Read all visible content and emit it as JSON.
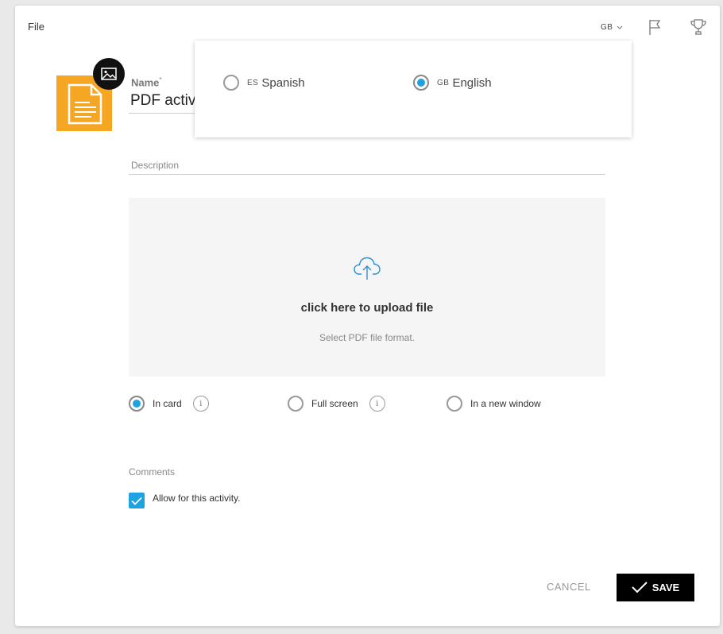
{
  "header": {
    "section_label": "File",
    "language_code": "GB"
  },
  "name_field": {
    "label": "Name",
    "required_mark": "*",
    "value": "PDF activity"
  },
  "description_field": {
    "label": "Description"
  },
  "upload": {
    "title": "click here to upload file",
    "hint": "Select PDF file format."
  },
  "display_options": [
    {
      "label": "In card",
      "selected": true,
      "info": "i"
    },
    {
      "label": "Full screen",
      "selected": false,
      "info": "i"
    },
    {
      "label": "In a new window",
      "selected": false
    }
  ],
  "comments": {
    "label": "Comments",
    "checkbox_label": "Allow for this activity.",
    "checked": true
  },
  "footer": {
    "cancel_label": "CANCEL",
    "save_label": "SAVE"
  },
  "language_dropdown": {
    "options": [
      {
        "code": "ES",
        "name": "Spanish",
        "selected": false
      },
      {
        "code": "GB",
        "name": "English",
        "selected": true
      }
    ]
  },
  "colors": {
    "accent": "#1fa3e0",
    "thumbnail": "#f5a623",
    "save_button": "#000000"
  }
}
